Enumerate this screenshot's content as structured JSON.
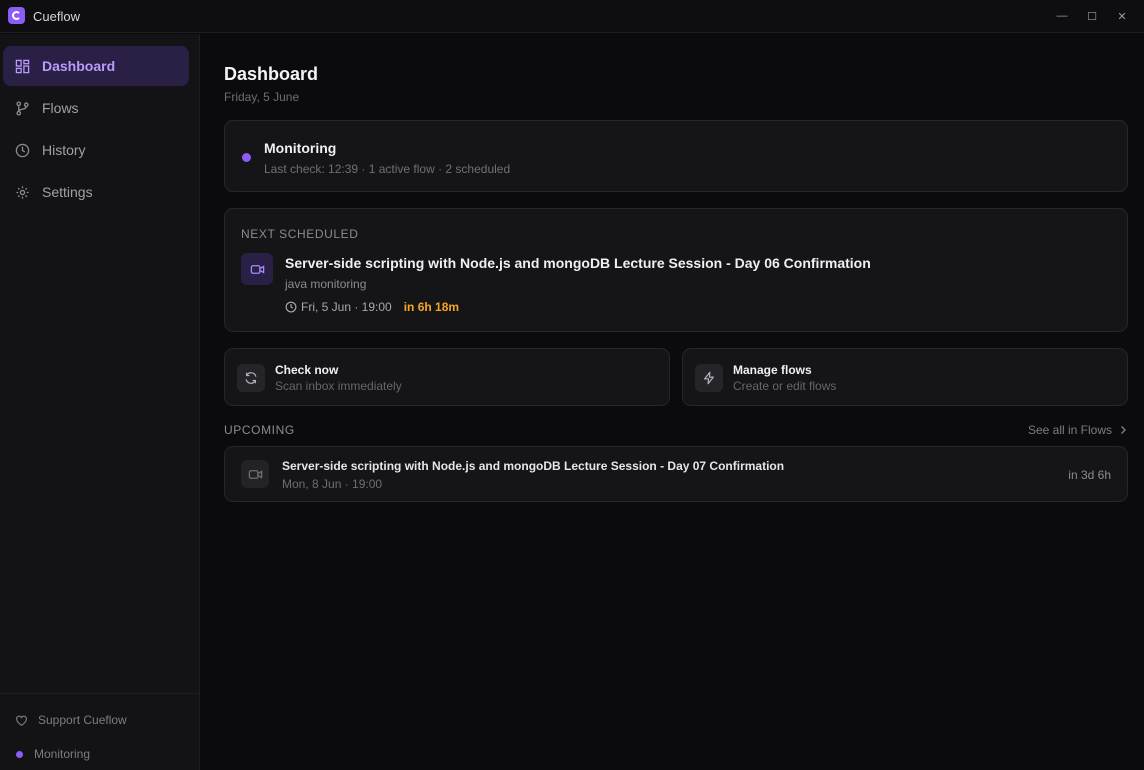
{
  "app": {
    "title": "Cueflow"
  },
  "window": {
    "minimize": "—",
    "maximize": "☐",
    "close": "✕"
  },
  "sidebar": {
    "items": [
      {
        "label": "Dashboard",
        "icon": "dashboard-icon",
        "active": true
      },
      {
        "label": "Flows",
        "icon": "flow-icon"
      },
      {
        "label": "History",
        "icon": "clock-icon"
      },
      {
        "label": "Settings",
        "icon": "gear-icon"
      }
    ],
    "footer": {
      "support": "Support Cueflow",
      "status": "Monitoring"
    }
  },
  "header": {
    "title": "Dashboard",
    "date": "Friday, 5 June"
  },
  "status": {
    "title": "Monitoring",
    "subtitle": "Last check: 12:39 · 1 active flow · 2 scheduled"
  },
  "next": {
    "label": "NEXT SCHEDULED",
    "title": "Server-side scripting with Node.js and mongoDB Lecture Session - Day 06 Confirmation",
    "flow": "java monitoring",
    "datetime": "Fri, 5 Jun · 19:00",
    "countdown": "in 6h 18m"
  },
  "actions": [
    {
      "title": "Check now",
      "subtitle": "Scan inbox immediately",
      "icon": "refresh-icon"
    },
    {
      "title": "Manage flows",
      "subtitle": "Create or edit flows",
      "icon": "lightning-icon"
    }
  ],
  "upcoming": {
    "label": "UPCOMING",
    "see_all": "See all in Flows",
    "items": [
      {
        "title": "Server-side scripting with Node.js and mongoDB Lecture Session - Day 07 Confirmation",
        "datetime": "Mon, 8 Jun · 19:00",
        "relative": "in 3d 6h"
      }
    ]
  },
  "colors": {
    "accent": "#8b5cf6",
    "countdown": "#f5a524",
    "background": "#0b0b0d"
  }
}
